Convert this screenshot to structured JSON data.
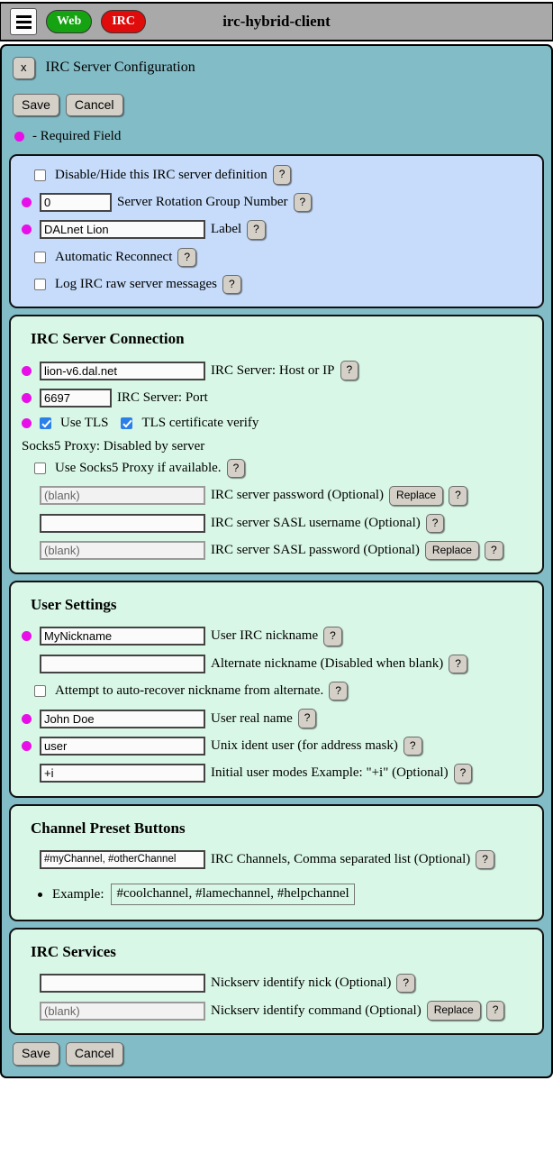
{
  "header": {
    "menu_icon": "hamburger-icon",
    "web_label": "Web",
    "irc_label": "IRC",
    "title": "irc-hybrid-client"
  },
  "colors": {
    "header_bg": "#a9a9a9",
    "panel_bg": "#82bcc6",
    "section_blue": "#c6dcfa",
    "section_mint": "#d8f7e6",
    "required_dot": "#e80ee8",
    "web_pill": "#16a312",
    "irc_pill": "#e00b0b",
    "checkbox_checked": "#2b7fe8"
  },
  "panel": {
    "close_label": "x",
    "page_title": "IRC Server Configuration",
    "save_label": "Save",
    "cancel_label": "Cancel",
    "required_legend": "- Required Field",
    "help_label": "?",
    "replace_label": "Replace",
    "bottom_save_label": "Save",
    "bottom_cancel_label": "Cancel"
  },
  "server_definition": {
    "disable_hide": {
      "label": "Disable/Hide this IRC server definition",
      "checked": false
    },
    "rotation_group": {
      "value": "0",
      "label": "Server Rotation Group Number",
      "required": true
    },
    "server_label": {
      "value": "DALnet Lion",
      "label": "Label",
      "required": true
    },
    "auto_reconnect": {
      "label": "Automatic Reconnect",
      "checked": false
    },
    "log_raw": {
      "label": "Log IRC raw server messages",
      "checked": false
    }
  },
  "connection": {
    "heading": "IRC Server Connection",
    "host": {
      "value": "lion-v6.dal.net",
      "label": "IRC Server: Host or IP",
      "required": true
    },
    "port": {
      "value": "6697",
      "label": "IRC Server: Port",
      "required": true
    },
    "use_tls": {
      "label": "Use TLS",
      "checked": true
    },
    "tls_verify": {
      "label": "TLS certificate verify",
      "checked": true
    },
    "socks5_status": "Socks5 Proxy: Disabled by server",
    "socks5_use": {
      "label": "Use Socks5 Proxy if available.",
      "checked": false
    },
    "server_password": {
      "value": "(blank)",
      "label": "IRC server password (Optional)",
      "disabled": true
    },
    "sasl_username": {
      "value": "",
      "label": "IRC server SASL username (Optional)"
    },
    "sasl_password": {
      "value": "(blank)",
      "label": "IRC server SASL password (Optional)",
      "disabled": true
    }
  },
  "user_settings": {
    "heading": "User Settings",
    "nickname": {
      "value": "MyNickname",
      "label": "User IRC nickname",
      "required": true
    },
    "alt_nickname": {
      "value": "",
      "label": "Alternate nickname (Disabled when blank)"
    },
    "auto_recover": {
      "label": "Attempt to auto-recover nickname from alternate.",
      "checked": false
    },
    "real_name": {
      "value": "John Doe",
      "label": "User real name",
      "required": true
    },
    "ident_user": {
      "value": "user",
      "label": "Unix ident user (for address mask)",
      "required": true
    },
    "user_modes": {
      "value": "+i",
      "label": "Initial user modes Example: \"+i\" (Optional)"
    }
  },
  "channel_presets": {
    "heading": "Channel Preset Buttons",
    "channels": {
      "value": "#myChannel, #otherChannel",
      "label": "IRC Channels, Comma separated list (Optional)"
    },
    "example_prefix": "Example:",
    "example_value": "#coolchannel, #lamechannel, #helpchannel"
  },
  "irc_services": {
    "heading": "IRC Services",
    "nickserv_nick": {
      "value": "",
      "label": "Nickserv identify nick (Optional)"
    },
    "nickserv_command": {
      "value": "(blank)",
      "label": "Nickserv identify command (Optional)",
      "disabled": true
    }
  }
}
